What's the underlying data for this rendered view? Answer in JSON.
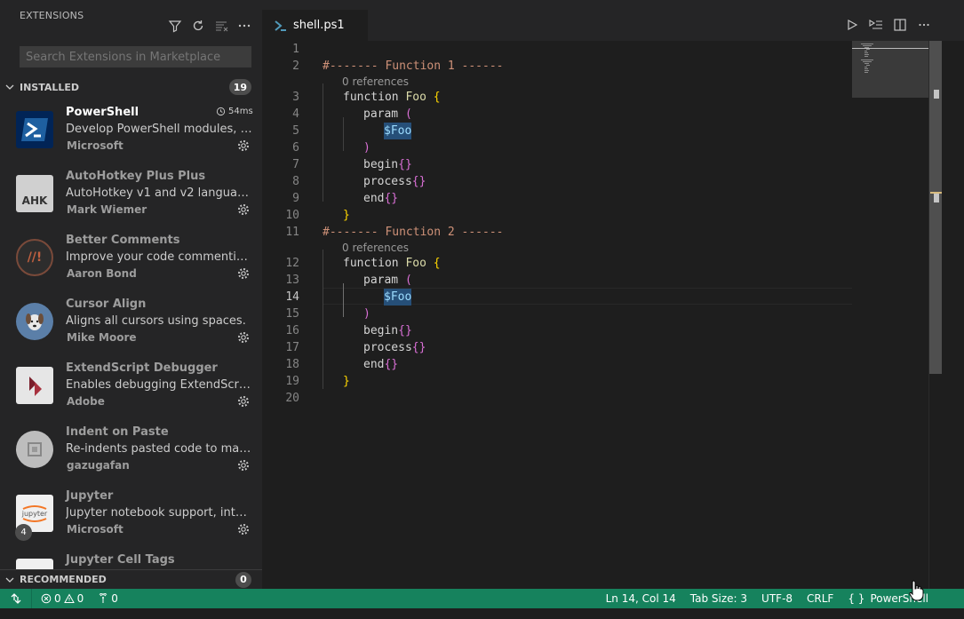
{
  "sidebar": {
    "title": "EXTENSIONS",
    "search_placeholder": "Search Extensions in Marketplace",
    "installed_label": "INSTALLED",
    "installed_count": "19",
    "recommended_label": "RECOMMENDED",
    "recommended_count": "0",
    "extensions": [
      {
        "name": "PowerShell",
        "desc": "Develop PowerShell modules, com...",
        "publisher": "Microsoft",
        "time": "54ms",
        "icon": "powershell-icon",
        "color": "#012456"
      },
      {
        "name": "AutoHotkey Plus Plus",
        "desc": "AutoHotkey v1 and v2 language s...",
        "publisher": "Mark Wiemer",
        "icon": "ahk-icon",
        "logo_text": "AHK",
        "color": "#d0d0d0"
      },
      {
        "name": "Better Comments",
        "desc": "Improve your code commenting b...",
        "publisher": "Aaron Bond",
        "icon": "better-comments-icon",
        "logo_text": "//!",
        "color": "#2d2d2d"
      },
      {
        "name": "Cursor Align",
        "desc": "Aligns all cursors using spaces.",
        "publisher": "Mike Moore",
        "icon": "dog-icon",
        "color": "#5b7fa8"
      },
      {
        "name": "ExtendScript Debugger",
        "desc": "Enables debugging ExtendScript-b...",
        "publisher": "Adobe",
        "icon": "extendscript-icon",
        "color": "#e6e6e6"
      },
      {
        "name": "Indent on Paste",
        "desc": "Re-indents pasted code to match t...",
        "publisher": "gazugafan",
        "icon": "indent-icon",
        "color": "#bdbdbd"
      },
      {
        "name": "Jupyter",
        "desc": "Jupyter notebook support, interact...",
        "publisher": "Microsoft",
        "icon": "jupyter-icon",
        "logo_text": "jupyter",
        "count": "4",
        "color": "#f0f0f0"
      },
      {
        "name": "Jupyter Cell Tags",
        "desc": "",
        "publisher": "",
        "icon": "jupyter-icon",
        "color": "#f0f0f0"
      }
    ]
  },
  "editor": {
    "tab_label": "shell.ps1",
    "lines": [
      {
        "n": "1",
        "code": ""
      },
      {
        "n": "2",
        "code": "#------- Function 1 ------"
      },
      {
        "lens": "0 references"
      },
      {
        "n": "3",
        "code": "function Foo {"
      },
      {
        "n": "4",
        "code": "param ("
      },
      {
        "n": "5",
        "code": "$Foo"
      },
      {
        "n": "6",
        "code": ")"
      },
      {
        "n": "7",
        "code": "begin{}"
      },
      {
        "n": "8",
        "code": "process{}"
      },
      {
        "n": "9",
        "code": "end{}"
      },
      {
        "n": "10",
        "code": "}"
      },
      {
        "n": "11",
        "code": "#------- Function 2 ------"
      },
      {
        "lens": "0 references"
      },
      {
        "n": "12",
        "code": "function Foo {"
      },
      {
        "n": "13",
        "code": "param ("
      },
      {
        "n": "14",
        "code": "$Foo"
      },
      {
        "n": "15",
        "code": ")"
      },
      {
        "n": "16",
        "code": "begin{}"
      },
      {
        "n": "17",
        "code": "process{}"
      },
      {
        "n": "18",
        "code": "end{}"
      },
      {
        "n": "19",
        "code": "}"
      },
      {
        "n": "20",
        "code": ""
      }
    ]
  },
  "status": {
    "errors": "0",
    "warnings": "0",
    "ports": "0",
    "position": "Ln 14, Col 14",
    "tab_size": "Tab Size: 3",
    "encoding": "UTF-8",
    "eol": "CRLF",
    "language": "PowerShell",
    "bg_color": "#16825d"
  }
}
